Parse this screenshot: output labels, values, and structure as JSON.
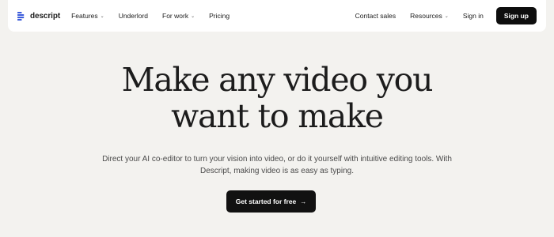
{
  "nav": {
    "logo_text": "descript",
    "left_items": [
      {
        "label": "Features",
        "has_dropdown": true
      },
      {
        "label": "Underlord",
        "has_dropdown": false
      },
      {
        "label": "For work",
        "has_dropdown": true
      },
      {
        "label": "Pricing",
        "has_dropdown": false
      }
    ],
    "right_items": [
      {
        "label": "Contact sales",
        "has_dropdown": false
      },
      {
        "label": "Resources",
        "has_dropdown": true
      },
      {
        "label": "Sign in",
        "has_dropdown": false
      }
    ],
    "signup_label": "Sign up",
    "chevron_icon": "chevron-down-icon"
  },
  "hero": {
    "title_line1": "Make any video you",
    "title_line2": "want to make",
    "subtitle_line1": "Direct your AI co-editor to turn your vision into video, or do it yourself with intuitive editing tools. With",
    "subtitle_line2": "Descript, making video is as easy as typing.",
    "cta_label": "Get started for free",
    "cta_icon": "arrow-right-icon"
  },
  "colors": {
    "background": "#f3f2ef",
    "nav_background": "#ffffff",
    "button_dark": "#111111",
    "logo_accent": "#3b5bdb"
  }
}
